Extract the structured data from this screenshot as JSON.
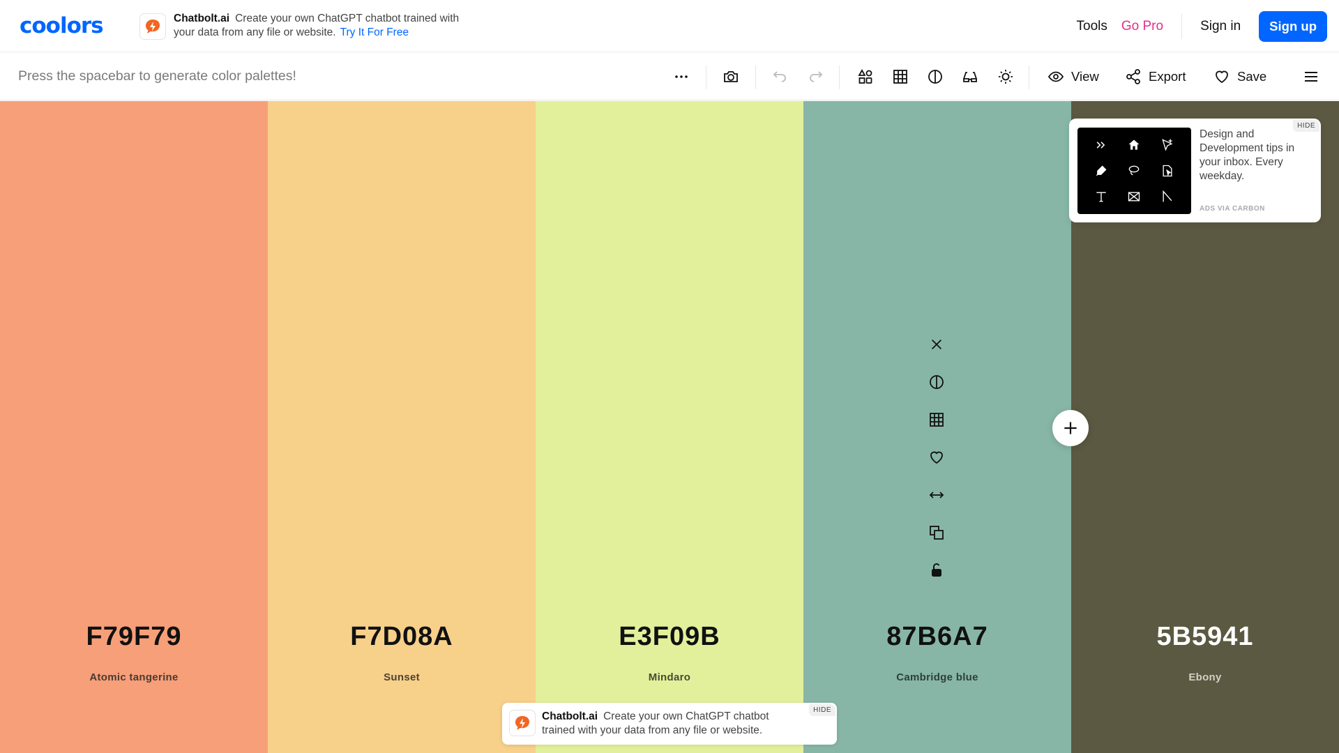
{
  "header": {
    "logo": "coolors",
    "ad": {
      "brand": "Chatbolt.ai",
      "text": "Create your own ChatGPT chatbot trained with your data from any file or website.",
      "cta": "Try It For Free"
    },
    "nav": {
      "tools": "Tools",
      "go_pro": "Go Pro",
      "sign_in": "Sign in",
      "sign_up": "Sign up"
    }
  },
  "toolbar": {
    "hint": "Press the spacebar to generate color palettes!",
    "view": "View",
    "export": "Export",
    "save": "Save"
  },
  "palette": [
    {
      "hex": "F79F79",
      "name": "Atomic tangerine",
      "color": "#F79F79",
      "text_color": "#111111",
      "name_color": "#4a3a32"
    },
    {
      "hex": "F7D08A",
      "name": "Sunset",
      "color": "#F7D08A",
      "text_color": "#111111",
      "name_color": "#4d4432"
    },
    {
      "hex": "E3F09B",
      "name": "Mindaro",
      "color": "#E3F09B",
      "text_color": "#111111",
      "name_color": "#474c34"
    },
    {
      "hex": "87B6A7",
      "name": "Cambridge blue",
      "color": "#87B6A7",
      "text_color": "#111111",
      "name_color": "#2f3f3a"
    },
    {
      "hex": "5B5941",
      "name": "Ebony",
      "color": "#5B5941",
      "text_color": "#ffffff",
      "name_color": "#d2d1c6"
    }
  ],
  "carbon_ad": {
    "text": "Design and Development tips in your inbox. Every weekday.",
    "via": "ADS VIA CARBON",
    "hide": "HIDE"
  },
  "bottom_ad": {
    "brand": "Chatbolt.ai",
    "text": "Create your own ChatGPT chatbot trained with your data from any file or website.",
    "hide": "HIDE"
  },
  "colors": {
    "accent": "#0066ff",
    "pro": "#e72d8e"
  }
}
